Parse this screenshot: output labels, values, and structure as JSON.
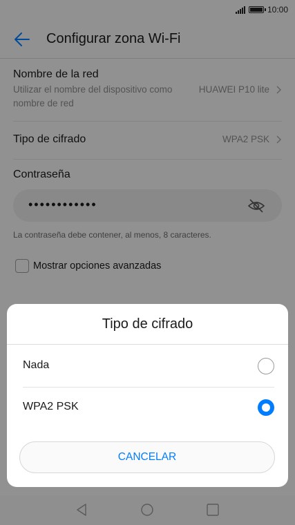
{
  "status_bar": {
    "time": "10:00",
    "icons": [
      "signal-icon",
      "battery-icon"
    ]
  },
  "app_bar": {
    "title": "Configurar zona Wi-Fi",
    "back_icon": "arrow-left-icon"
  },
  "settings": {
    "network_name": {
      "title": "Nombre de la red",
      "subtitle": "Utilizar el nombre del dispositivo como nombre de red",
      "value": "HUAWEI P10 lite"
    },
    "encryption": {
      "title": "Tipo de cifrado",
      "value": "WPA2 PSK"
    },
    "password": {
      "title": "Contraseña",
      "value": "••••••••••••",
      "hint": "La contraseña debe contener, al menos, 8 caracteres."
    },
    "advanced": {
      "label": "Mostrar opciones avanzadas",
      "checked": false
    }
  },
  "dialog": {
    "title": "Tipo de cifrado",
    "options": [
      {
        "label": "Nada",
        "selected": false
      },
      {
        "label": "WPA2 PSK",
        "selected": true
      }
    ],
    "cancel_label": "CANCELAR"
  },
  "colors": {
    "accent": "#007dff",
    "background": "#f2f2f2",
    "scrim": "rgba(0,0,0,0.40)"
  }
}
